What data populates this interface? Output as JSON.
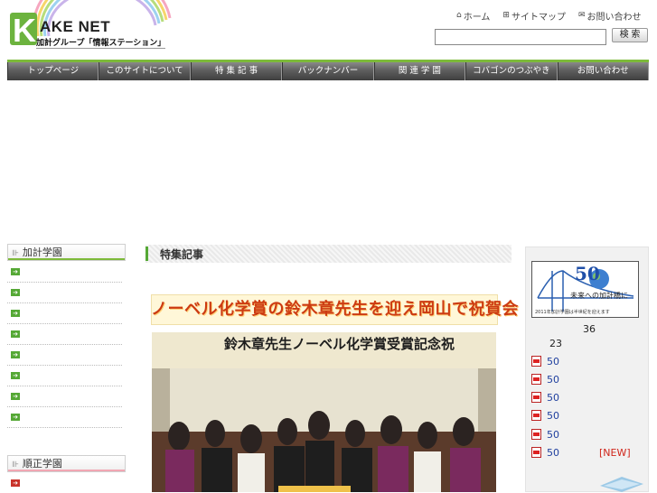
{
  "header": {
    "logo_text": "AKE NET",
    "logo_sub": "加計グループ「情報ステーション」",
    "links": [
      {
        "icon": "home-icon",
        "label": "ホーム"
      },
      {
        "icon": "sitemap-icon",
        "label": "サイトマップ"
      },
      {
        "icon": "mail-icon",
        "label": "お問い合わせ"
      }
    ],
    "search_placeholder": "",
    "search_button": "検 索"
  },
  "nav": {
    "items": [
      "トップページ",
      "このサイトについて",
      "特 集 記 事",
      "バックナンバー",
      "関 連 学 園",
      "コバゴンのつぶやき",
      "お問い合わせ"
    ]
  },
  "sidebar": {
    "groups": [
      {
        "title": "加計学園",
        "item_count": 8
      },
      {
        "title": "順正学園",
        "item_count": 1
      }
    ]
  },
  "main": {
    "section_title": "特集記事",
    "headline": "ノーベル化学賞の鈴木章先生を迎え岡山で祝賀会",
    "photo_banner": "鈴木章先生ノーベル化学賞受賞記念祝"
  },
  "right": {
    "banner_number": "50",
    "banner_line1": "未来への加計橋に",
    "banner_line2": "2011年加計学園は半世紀を迎えます",
    "num_36": "36",
    "num_23": "23",
    "news": [
      "50",
      "50",
      "50",
      "50",
      "50",
      "50"
    ],
    "new_badge": "[NEW]"
  },
  "colors": {
    "accent_green": "#7dba3a",
    "nav_dark": "#4a4a4a",
    "headline_red": "#cc3b12"
  }
}
